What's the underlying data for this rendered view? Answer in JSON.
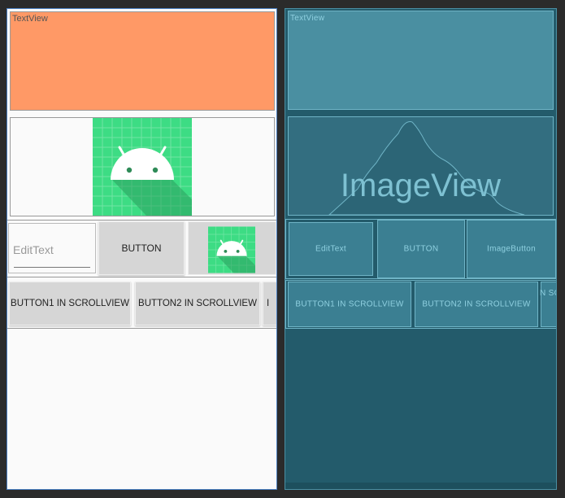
{
  "design": {
    "textview_label": "TextView",
    "edittext_hint": "EditText",
    "button_label": "BUTTON",
    "scroll_buttons": [
      "BUTTON1 IN SCROLLVIEW",
      "BUTTON2 IN SCROLLVIEW",
      "I"
    ]
  },
  "blueprint": {
    "textview_label": "TextView",
    "imageview_label": "ImageView",
    "edittext_label": "EditText",
    "button_label": "BUTTON",
    "imagebutton_label": "ImageButton",
    "scroll_buttons": [
      "BUTTON1 IN SCROLLVIEW",
      "BUTTON2 IN SCROLLVIEW",
      "N SC"
    ]
  },
  "colors": {
    "textview_bg": "#ff9966",
    "android_green": "#3ddc84",
    "blueprint_bg": "#235b6b"
  }
}
